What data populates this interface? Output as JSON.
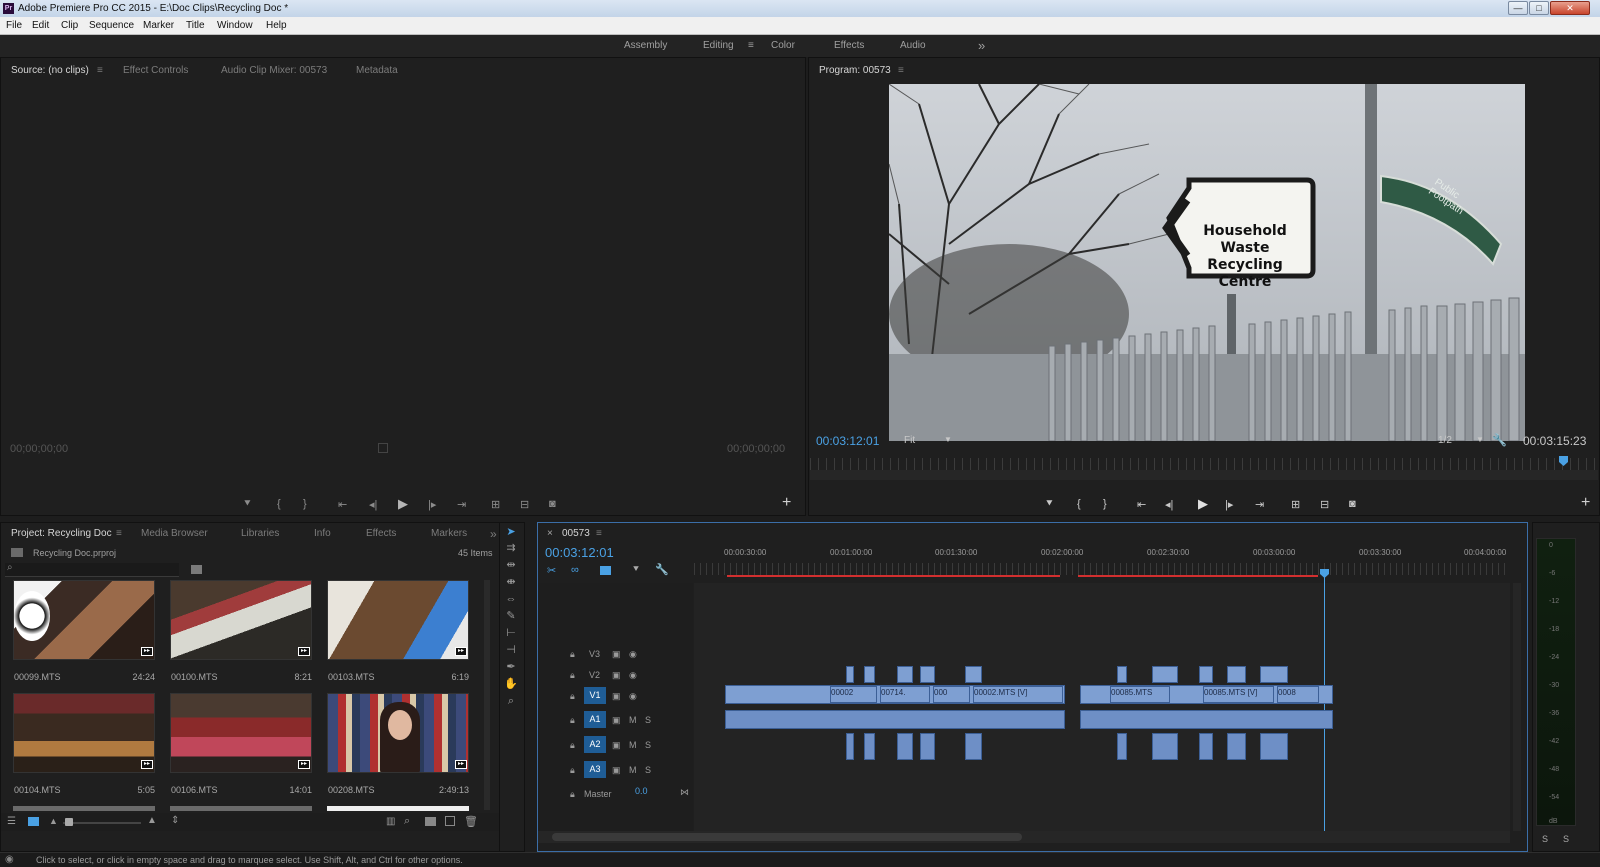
{
  "window": {
    "title": "Adobe Premiere Pro CC 2015 - E:\\Doc Clips\\Recycling Doc *",
    "logo_text": "Pr",
    "min_glyph": "—",
    "max_glyph": "□",
    "close_glyph": "✕"
  },
  "menu": [
    "File",
    "Edit",
    "Clip",
    "Sequence",
    "Marker",
    "Title",
    "Window",
    "Help"
  ],
  "workspaces": {
    "items": [
      "Assembly",
      "Editing",
      "Color",
      "Effects",
      "Audio"
    ],
    "active": "Editing",
    "menu_glyph": "≡",
    "overflow_glyph": "»"
  },
  "source_panel": {
    "tabs": [
      "Source: (no clips)",
      "Effect Controls",
      "Audio Clip Mixer: 00573",
      "Metadata"
    ],
    "menu_glyph": "≡",
    "timecode_left": "00;00;00;00",
    "timecode_right": "00;00;00;00",
    "add_glyph": "+"
  },
  "program_panel": {
    "tab": "Program: 00573",
    "menu_glyph": "≡",
    "timecode_current": "00:03:12:01",
    "timecode_duration": "00:03:15:23",
    "zoom": "Fit",
    "resolution": "1/2",
    "add_glyph": "+",
    "sign": {
      "lines": [
        "Household",
        "Waste",
        "Recycling",
        "Centre"
      ],
      "footpath_lines": [
        "Public",
        "Footpath"
      ]
    }
  },
  "project_panel": {
    "tabs": [
      "Project: Recycling Doc",
      "Media Browser",
      "Libraries",
      "Info",
      "Effects",
      "Markers"
    ],
    "menu_glyph": "≡",
    "overflow_glyph": "»",
    "project_file": "Recycling Doc.prproj",
    "item_count": "45 Items",
    "clips": [
      {
        "name": "00099.MTS",
        "duration": "24:24"
      },
      {
        "name": "00100.MTS",
        "duration": "8:21"
      },
      {
        "name": "00103.MTS",
        "duration": "6:19"
      },
      {
        "name": "00104.MTS",
        "duration": "5:05"
      },
      {
        "name": "00106.MTS",
        "duration": "14:01"
      },
      {
        "name": "00208.MTS",
        "duration": "2:49:13"
      }
    ]
  },
  "timeline": {
    "tab": "00573",
    "close_glyph": "×",
    "menu_glyph": "≡",
    "timecode": "00:03:12:01",
    "ruler": [
      "00:00:30:00",
      "00:01:00:00",
      "00:01:30:00",
      "00:02:00:00",
      "00:02:30:00",
      "00:03:00:00",
      "00:03:30:00",
      "00:04:00:00"
    ],
    "tracks": [
      {
        "name": "V3",
        "type": "video"
      },
      {
        "name": "V2",
        "type": "video"
      },
      {
        "name": "V1",
        "type": "video"
      },
      {
        "name": "A1",
        "type": "audio"
      },
      {
        "name": "A2",
        "type": "audio"
      },
      {
        "name": "A3",
        "type": "audio"
      }
    ],
    "master": {
      "label": "Master",
      "value": "0.0"
    },
    "mute_label": "M",
    "solo_label": "S",
    "clip_labels": [
      "00002",
      "00714.",
      "000",
      "00002.MTS [V]",
      "00085.MTS",
      "00085.MTS [V]",
      "0008"
    ]
  },
  "audio_meter": {
    "scale": [
      "0",
      "-6",
      "-12",
      "-18",
      "-24",
      "-30",
      "-36",
      "-42",
      "-48",
      "-54",
      "dB"
    ],
    "solo_buttons": [
      "S",
      "S"
    ]
  },
  "status_bar": {
    "message": "Click to select, or click in empty space and drag to marquee select. Use Shift, Alt, and Ctrl for other options."
  },
  "colors": {
    "accent_blue": "#4aa1e4",
    "clip_blue": "#7e9fd2",
    "render_bar_red": "#d22f2f",
    "panel_bg": "#1f1f1f"
  }
}
